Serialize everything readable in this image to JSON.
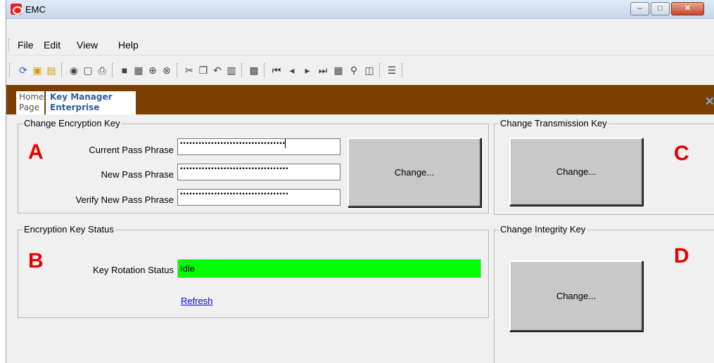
{
  "window": {
    "title": "EMC",
    "minimize_glyph": "–",
    "maximize_glyph": "□",
    "close_glyph": "✕"
  },
  "menu": {
    "items": [
      {
        "label": "File"
      },
      {
        "label": "Edit"
      },
      {
        "label": "View"
      },
      {
        "label": "Help"
      }
    ]
  },
  "tabs": {
    "home": {
      "line1": "Home",
      "line2": "Page"
    },
    "key_manager": {
      "line1": "Key Manager",
      "line2": "Enterprise"
    },
    "close_glyph": "✕"
  },
  "encryption_key": {
    "group_title": "Change Encryption Key",
    "current_label": "Current Pass Phrase",
    "current_value": "••••••••••••••••••••••••••••••••••",
    "new_label": "New Pass Phrase",
    "new_value": "•••••••••••••••••••••••••••••••••••",
    "verify_label": "Verify New Pass Phrase",
    "verify_value": "•••••••••••••••••••••••••••••••••••",
    "change_label": "Change..."
  },
  "status": {
    "group_title": "Encryption Key Status",
    "rotation_label": "Key Rotation Status",
    "rotation_value": "Idle",
    "refresh_label": "Refresh"
  },
  "transmission_key": {
    "group_title": "Change Transmission Key",
    "change_label": "Change..."
  },
  "integrity_key": {
    "group_title": "Change Integrity Key",
    "change_label": "Change..."
  },
  "markers": {
    "a": "A",
    "b": "B",
    "c": "C",
    "d": "D"
  },
  "colors": {
    "tab_strip": "#7b3f00",
    "status_idle": "#00ff00",
    "marker": "#e60000",
    "link": "#0000ee"
  }
}
